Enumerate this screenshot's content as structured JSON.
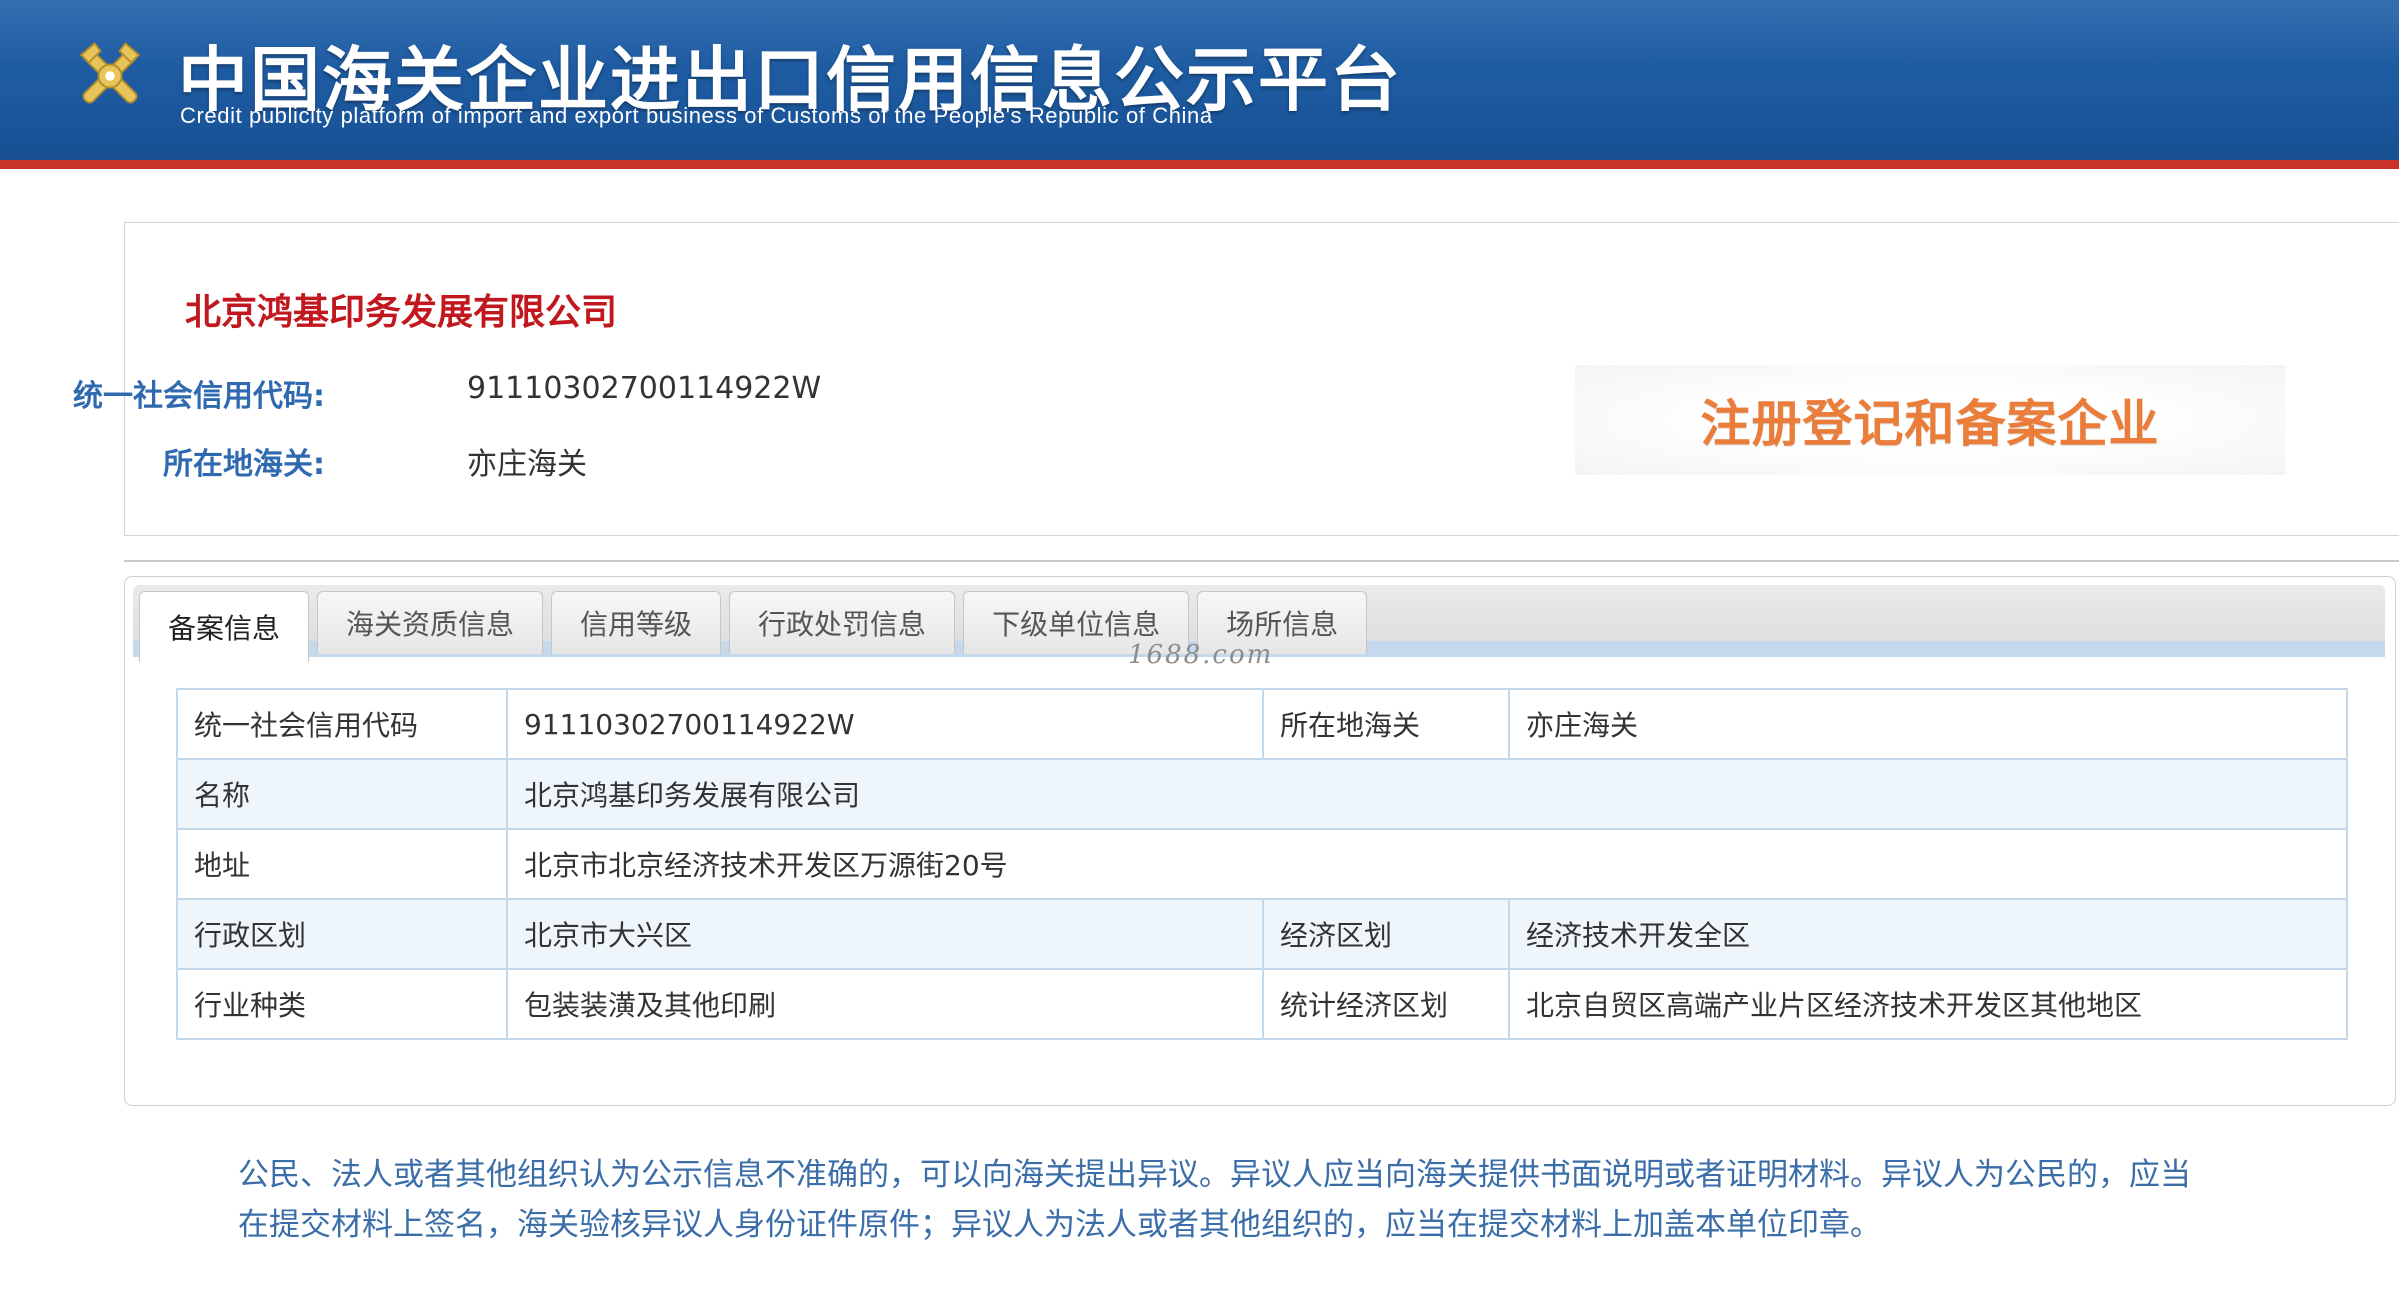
{
  "header": {
    "title": "中国海关企业进出口信用信息公示平台",
    "subtitle": "Credit publicity platform of import and export business of Customs of the People's Republic of China",
    "logo_icon": "customs-emblem-icon",
    "colors": {
      "bar": "#1d5aa0",
      "accent_line": "#c8322b"
    }
  },
  "company": {
    "name": "北京鸿基印务发展有限公司",
    "credit_code_label": "统一社会信用代码:",
    "credit_code": "91110302700114922W",
    "customs_label": "所在地海关:",
    "customs": "亦庄海关",
    "badge": "注册登记和备案企业",
    "name_color": "#c0181e",
    "badge_color": "#ea7d3a"
  },
  "tabs": [
    {
      "label": "备案信息",
      "active": true
    },
    {
      "label": "海关资质信息",
      "active": false
    },
    {
      "label": "信用等级",
      "active": false
    },
    {
      "label": "行政处罚信息",
      "active": false
    },
    {
      "label": "下级单位信息",
      "active": false
    },
    {
      "label": "场所信息",
      "active": false
    }
  ],
  "watermark": "1688.com",
  "record": {
    "credit_code_label": "统一社会信用代码",
    "credit_code": "91110302700114922W",
    "customs_label": "所在地海关",
    "customs": "亦庄海关",
    "name_label": "名称",
    "name": "北京鸿基印务发展有限公司",
    "address_label": "地址",
    "address": "北京市北京经济技术开发区万源街20号",
    "admin_region_label": "行政区划",
    "admin_region": "北京市大兴区",
    "econ_region_label": "经济区划",
    "econ_region": "经济技术开发全区",
    "industry_label": "行业种类",
    "industry": "包装装潢及其他印刷",
    "stat_region_label": "统计经济区划",
    "stat_region": "北京自贸区高端产业片区经济技术开发区其他地区"
  },
  "notice": {
    "line1": "公民、法人或者其他组织认为公示信息不准确的，可以向海关提出异议。异议人应当向海关提供书面说明或者证明材料。异议人为公民的，应当",
    "line2": "在提交材料上签名，海关验核异议人身份证件原件；异议人为法人或者其他组织的，应当在提交材料上加盖本单位印章。",
    "color": "#3b6ea8"
  }
}
